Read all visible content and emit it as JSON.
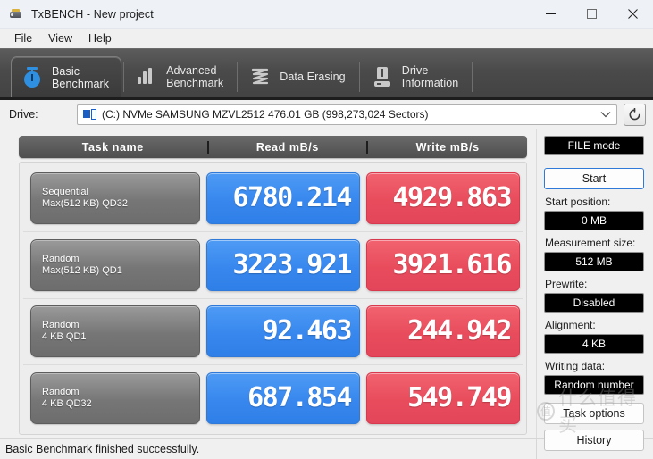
{
  "window": {
    "title": "TxBENCH - New project",
    "app_icon": "usb-drive-icon",
    "controls": {
      "minimize": "minimize-icon",
      "maximize": "maximize-icon",
      "close": "close-icon"
    }
  },
  "menu": {
    "items": [
      {
        "label": "File"
      },
      {
        "label": "View"
      },
      {
        "label": "Help"
      }
    ]
  },
  "tabs": [
    {
      "label": "Basic\nBenchmark",
      "icon": "stopwatch-icon",
      "active": true
    },
    {
      "label": "Advanced\nBenchmark",
      "icon": "bar-chart-icon",
      "active": false
    },
    {
      "label": "Data Erasing",
      "icon": "squiggle-erase-icon",
      "active": false
    },
    {
      "label": "Drive\nInformation",
      "icon": "drive-info-icon",
      "active": false
    }
  ],
  "drive": {
    "label": "Drive:",
    "icon": "drive-icon",
    "selected": "(C:) NVMe SAMSUNG MZVL2512  476.01 GB (998,273,024 Sectors)",
    "dropdown_icon": "chevron-down-icon",
    "refresh_icon": "refresh-icon"
  },
  "results": {
    "columns": [
      "Task name",
      "Read mB/s",
      "Write mB/s"
    ],
    "rows": [
      {
        "task": "Sequential\nMax(512 KB) QD32",
        "read": "6780.214",
        "write": "4929.863"
      },
      {
        "task": "Random\nMax(512 KB) QD1",
        "read": "3223.921",
        "write": "3921.616"
      },
      {
        "task": "Random\n4 KB QD1",
        "read": "92.463",
        "write": "244.942"
      },
      {
        "task": "Random\n4 KB QD32",
        "read": "687.854",
        "write": "549.749"
      }
    ]
  },
  "sidebar": {
    "mode": "FILE mode",
    "start_button": "Start",
    "start_position_label": "Start position:",
    "start_position_value": "0 MB",
    "measurement_size_label": "Measurement size:",
    "measurement_size_value": "512 MB",
    "prewrite_label": "Prewrite:",
    "prewrite_value": "Disabled",
    "alignment_label": "Alignment:",
    "alignment_value": "4 KB",
    "writing_data_label": "Writing data:",
    "writing_data_value": "Random number",
    "task_options_button": "Task options",
    "history_button": "History"
  },
  "watermark": {
    "badge": "值",
    "text": "什么值得买"
  },
  "statusbar": {
    "message": "Basic Benchmark finished successfully."
  },
  "colors": {
    "read": "#3787ee",
    "write": "#e84c5c",
    "tabstrip": "#4a4a4a",
    "accent": "#2f7ad8"
  }
}
